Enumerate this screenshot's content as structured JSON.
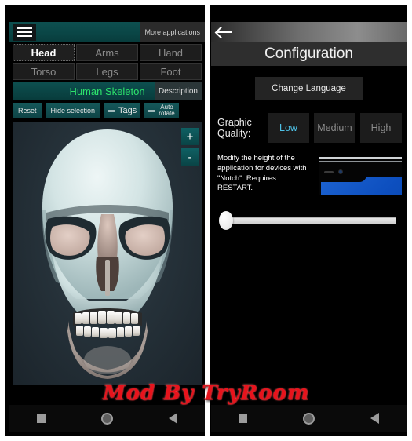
{
  "left_app": {
    "menu_icon": "hamburger-menu-icon",
    "more_applications_label": "More applications",
    "body_tabs": [
      {
        "label": "Head",
        "selected": true
      },
      {
        "label": "Arms",
        "selected": false
      },
      {
        "label": "Hand",
        "selected": false
      },
      {
        "label": "Torso",
        "selected": false
      },
      {
        "label": "Legs",
        "selected": false
      },
      {
        "label": "Foot",
        "selected": false
      }
    ],
    "title": "Human Skeleton",
    "description_label": "Description",
    "tools": {
      "reset_label": "Reset",
      "hide_selection_label": "Hide selection",
      "tags_label": "Tags",
      "auto_label": "Auto",
      "rotate_label": "rotate"
    },
    "zoom_in_label": "+",
    "zoom_out_label": "-",
    "viewport_content": "human-skull-3d-model"
  },
  "right_app": {
    "back_icon": "back-arrow-icon",
    "title": "Configuration",
    "change_language_label": "Change Language",
    "graphic_quality_label": "Graphic Quality:",
    "quality_options": [
      {
        "label": "Low",
        "selected": true
      },
      {
        "label": "Medium",
        "selected": false
      },
      {
        "label": "High",
        "selected": false
      }
    ],
    "notch_description": "Modify the height of the application for devices with \"Notch\". Requires RESTART.",
    "notch_image": "phone-notch-illustration",
    "slider_value": 0
  },
  "watermark": {
    "text": "Mod By TryRoom"
  },
  "navbar": {
    "recents_icon": "square-recents-icon",
    "home_icon": "circle-home-icon",
    "back_icon": "triangle-back-icon"
  },
  "colors": {
    "teal": "#0d4f4f",
    "title_green": "#2de36b",
    "accent_cyan": "#4fc3e8",
    "watermark_red": "#e8131c"
  }
}
